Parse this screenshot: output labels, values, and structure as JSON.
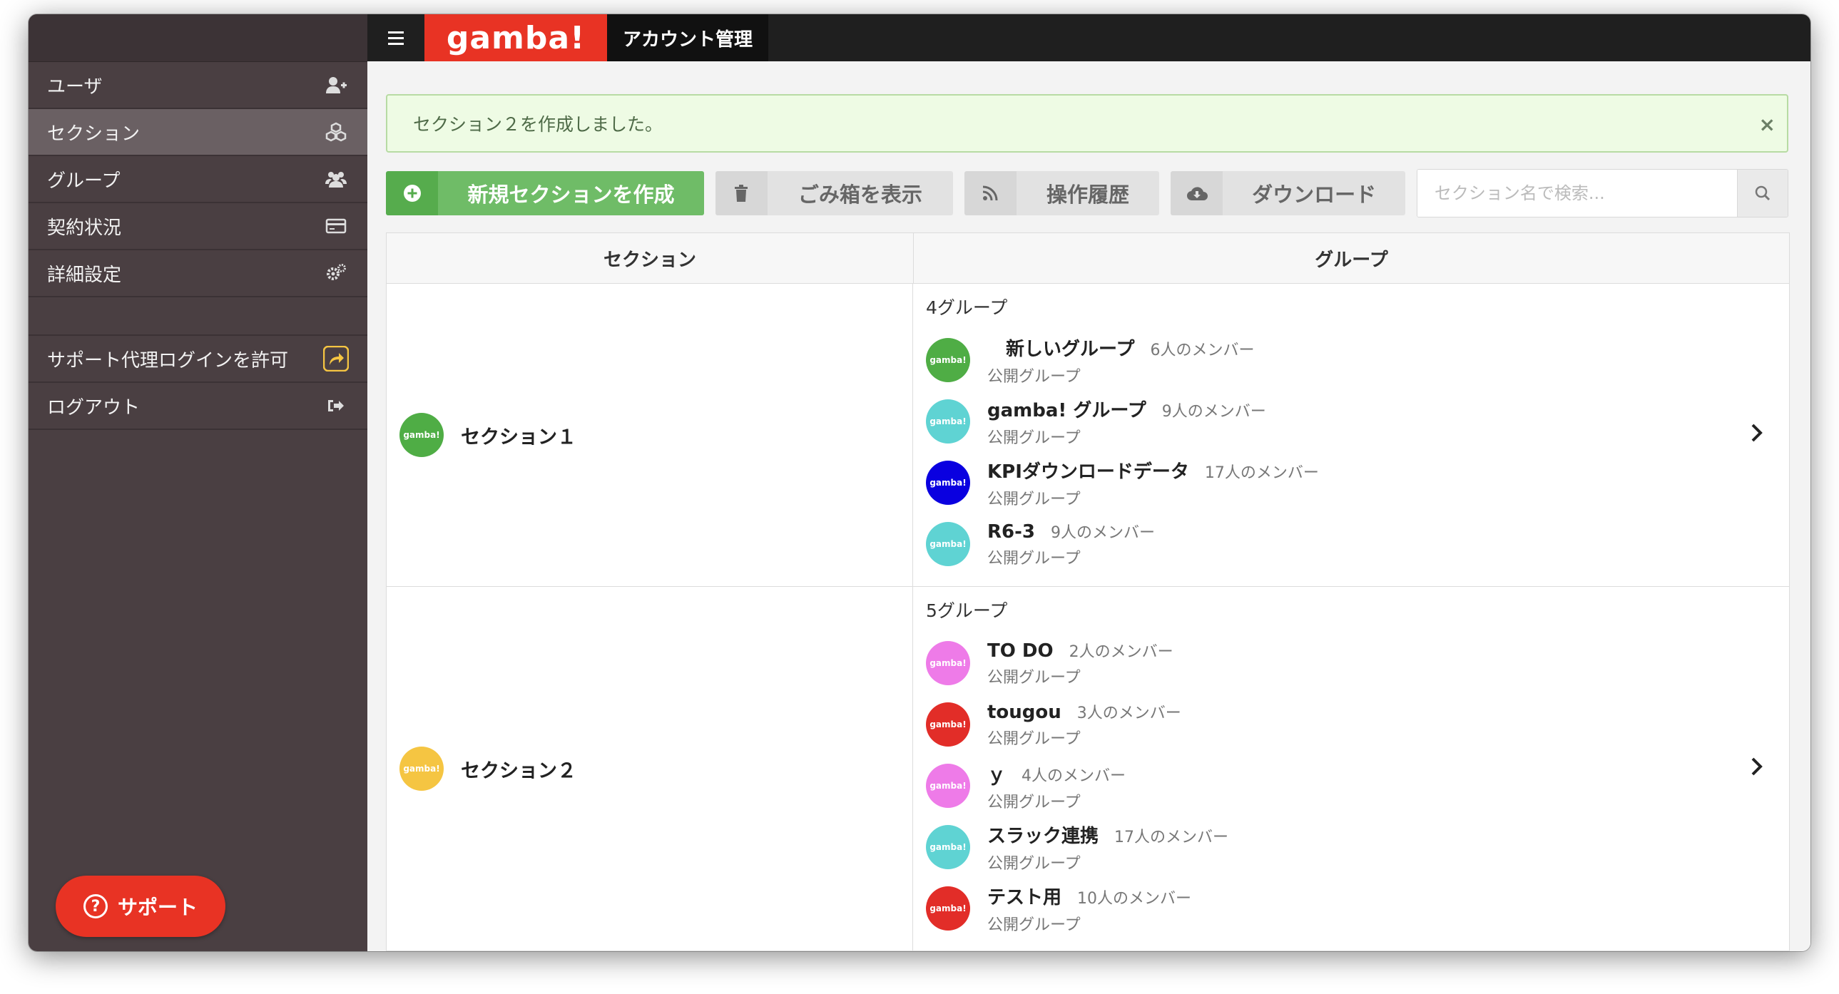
{
  "colors": {
    "brand_red": "#e83324",
    "sidebar_bg": "#4a3f42",
    "green": "#6fbc67"
  },
  "topbar": {
    "brand": "gamba!",
    "tab_title": "アカウント管理"
  },
  "sidebar": {
    "items": [
      {
        "label": "ユーザ",
        "icon": "add-user-icon"
      },
      {
        "label": "セクション",
        "icon": "cubes-icon"
      },
      {
        "label": "グループ",
        "icon": "users-icon"
      },
      {
        "label": "契約状況",
        "icon": "credit-card-icon"
      },
      {
        "label": "詳細設定",
        "icon": "gears-icon"
      }
    ],
    "items2": [
      {
        "label": "サポート代理ログインを許可",
        "icon": "share-icon"
      },
      {
        "label": "ログアウト",
        "icon": "sign-out-icon"
      }
    ],
    "support_label": "サポート"
  },
  "alert": {
    "message": "セクション２を作成しました。",
    "close": "×"
  },
  "toolbar": {
    "create_label": "新規セクションを作成",
    "trash_label": "ごみ箱を表示",
    "history_label": "操作履歴",
    "download_label": "ダウンロード",
    "search_placeholder": "セクション名で検索..."
  },
  "table": {
    "headers": {
      "section": "セクション",
      "group": "グループ"
    },
    "rows": [
      {
        "section_name": "セクション１",
        "section_color": "#4fad45",
        "group_count": "4グループ",
        "groups": [
          {
            "name": "　新しいグループ",
            "members": "6人のメンバー",
            "visibility": "公開グループ",
            "color": "#4fad45"
          },
          {
            "name": "gamba! グループ",
            "members": "9人のメンバー",
            "visibility": "公開グループ",
            "color": "#5fd3d3"
          },
          {
            "name": "KPIダウンロードデータ",
            "members": "17人のメンバー",
            "visibility": "公開グループ",
            "color": "#0a00e0"
          },
          {
            "name": "R6-3",
            "members": "9人のメンバー",
            "visibility": "公開グループ",
            "color": "#5fd3d3"
          }
        ]
      },
      {
        "section_name": "セクション２",
        "section_color": "#f5c542",
        "group_count": "5グループ",
        "groups": [
          {
            "name": "TO DO",
            "members": "2人のメンバー",
            "visibility": "公開グループ",
            "color": "#ee7be8"
          },
          {
            "name": "tougou",
            "members": "3人のメンバー",
            "visibility": "公開グループ",
            "color": "#e22d28"
          },
          {
            "name": "ｙ",
            "members": "4人のメンバー",
            "visibility": "公開グループ",
            "color": "#ee7be8"
          },
          {
            "name": "スラック連携",
            "members": "17人のメンバー",
            "visibility": "公開グループ",
            "color": "#5fd3d3"
          },
          {
            "name": "テスト用",
            "members": "10人のメンバー",
            "visibility": "公開グループ",
            "color": "#e22d28"
          }
        ]
      }
    ],
    "avatar_text": "gamba!"
  }
}
